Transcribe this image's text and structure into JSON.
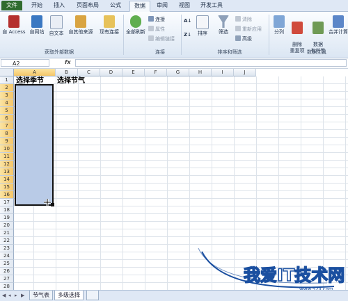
{
  "ribbon_tabs": [
    "文件",
    "开始",
    "插入",
    "页面布局",
    "公式",
    "数据",
    "审阅",
    "视图",
    "开发工具"
  ],
  "active_tab": "数据",
  "groups": {
    "external": {
      "label": "获取外部数据",
      "buttons": [
        "自 Access",
        "自网站",
        "自文本",
        "自其他来源",
        "现有连接"
      ]
    },
    "connections": {
      "label": "连接",
      "refresh": "全部刷新",
      "items": [
        "连接",
        "属性",
        "编辑链接"
      ]
    },
    "sort_filter": {
      "label": "排序和筛选",
      "sort": "排序",
      "filter": "筛选",
      "items": [
        "清除",
        "重新应用",
        "高级"
      ]
    },
    "tools": {
      "label": "数据工具",
      "buttons": [
        "分列",
        "删除\n重复项",
        "数据\n有效性",
        "合并计算"
      ]
    }
  },
  "formula_bar": {
    "name_box": "A2",
    "fx": "fx",
    "value": ""
  },
  "columns": [
    "A",
    "B",
    "C",
    "D",
    "E",
    "F",
    "G",
    "H",
    "I",
    "J"
  ],
  "selected_column": "A",
  "rows": [
    "1",
    "2",
    "3",
    "4",
    "5",
    "6",
    "7",
    "8",
    "9",
    "10",
    "11",
    "12",
    "13",
    "14",
    "15",
    "16",
    "17",
    "18",
    "19",
    "20",
    "21",
    "22",
    "23",
    "24",
    "25",
    "26",
    "27",
    "28"
  ],
  "cells": {
    "A1": "选择季节",
    "B1": "选择节气"
  },
  "sheets": [
    "节气表",
    "多级选择"
  ],
  "active_sheet": "多级选择",
  "watermark": {
    "text": "我爱IT技术网",
    "url": "www.52ij.com"
  },
  "colors": {
    "file_tab": "#2f6b2f",
    "selection_fill": "#b9cbe7",
    "header_selected": "#f5c668",
    "watermark": "#1a4fa0"
  }
}
